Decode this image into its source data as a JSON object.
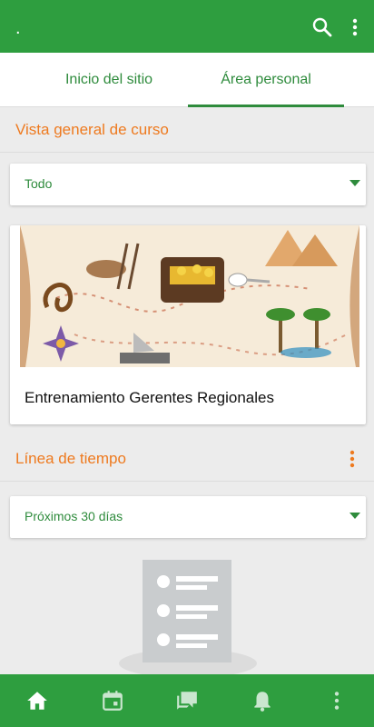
{
  "appbar": {
    "title": "."
  },
  "tabs": [
    {
      "label": "Inicio del sitio"
    },
    {
      "label": "Área personal"
    }
  ],
  "course_overview": {
    "heading": "Vista general de curso",
    "filter": "Todo",
    "course_name": "Entrenamiento Gerentes Regionales"
  },
  "timeline": {
    "heading": "Línea de tiempo",
    "filter": "Próximos 30 días"
  },
  "colors": {
    "primary": "#2e9e3f",
    "accent": "#ee7a1f",
    "link": "#2e8b3c"
  },
  "bottom_nav": [
    "home-icon",
    "calendar-icon",
    "messages-icon",
    "notifications-icon",
    "more-icon"
  ]
}
